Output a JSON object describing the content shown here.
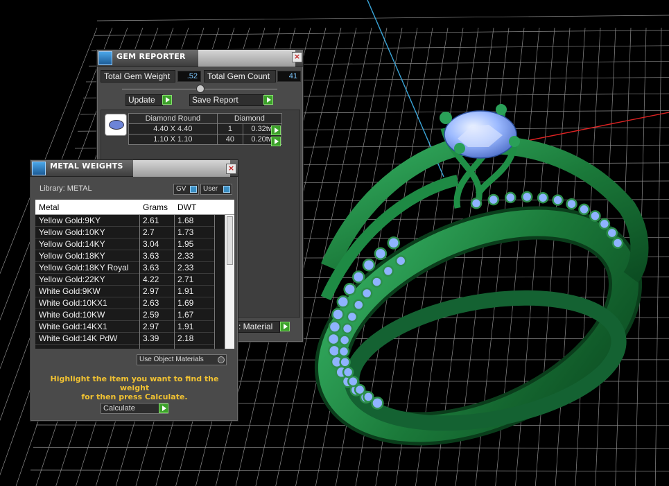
{
  "gem_reporter": {
    "title": "GEM REPORTER",
    "total_gem_weight_label": "Total Gem Weight",
    "total_gem_weight_value": ".52",
    "total_gem_count_label": "Total Gem Count",
    "total_gem_count_value": "41",
    "update_label": "Update",
    "save_report_label": "Save Report",
    "table_header_shape": "Diamond Round",
    "table_header_material": "Diamond",
    "rows": [
      {
        "size": "4.40 X 4.40",
        "count": "1",
        "weight": "0.32tw"
      },
      {
        "size": "1.10 X 1.10",
        "count": "40",
        "weight": "0.20tw"
      }
    ],
    "material_button_label": ": Material"
  },
  "metal_weights": {
    "title": "METAL WEIGHTS",
    "library_label": "Library: METAL",
    "gv_label": "GV",
    "user_label": "User",
    "columns": {
      "metal": "Metal",
      "grams": "Grams",
      "dwt": "DWT"
    },
    "rows": [
      {
        "metal": "Yellow Gold:9KY",
        "grams": "2.61",
        "dwt": "1.68"
      },
      {
        "metal": "Yellow Gold:10KY",
        "grams": "2.7",
        "dwt": "1.73"
      },
      {
        "metal": "Yellow Gold:14KY",
        "grams": "3.04",
        "dwt": "1.95"
      },
      {
        "metal": "Yellow Gold:18KY",
        "grams": "3.63",
        "dwt": "2.33"
      },
      {
        "metal": "Yellow Gold:18KY Royal",
        "grams": "3.63",
        "dwt": "2.33"
      },
      {
        "metal": "Yellow Gold:22KY",
        "grams": "4.22",
        "dwt": "2.71"
      },
      {
        "metal": "White Gold:9KW",
        "grams": "2.97",
        "dwt": "1.91"
      },
      {
        "metal": "White Gold:10KX1",
        "grams": "2.63",
        "dwt": "1.69"
      },
      {
        "metal": "White Gold:10KW",
        "grams": "2.59",
        "dwt": "1.67"
      },
      {
        "metal": "White Gold:14KX1",
        "grams": "2.97",
        "dwt": "1.91"
      },
      {
        "metal": "White Gold:14K PdW",
        "grams": "3.39",
        "dwt": "2.18"
      }
    ],
    "use_object_materials_label": "Use Object Materials",
    "instructions_line1": "Highlight the item you want to find the weight",
    "instructions_line2": "for then press Calculate.",
    "calculate_label": "Calculate"
  },
  "colors": {
    "ring_metal": "#1f8a43",
    "gem": "#8fb3ff",
    "grid": "#8c8c8c",
    "accent_text": "#f1c232"
  }
}
